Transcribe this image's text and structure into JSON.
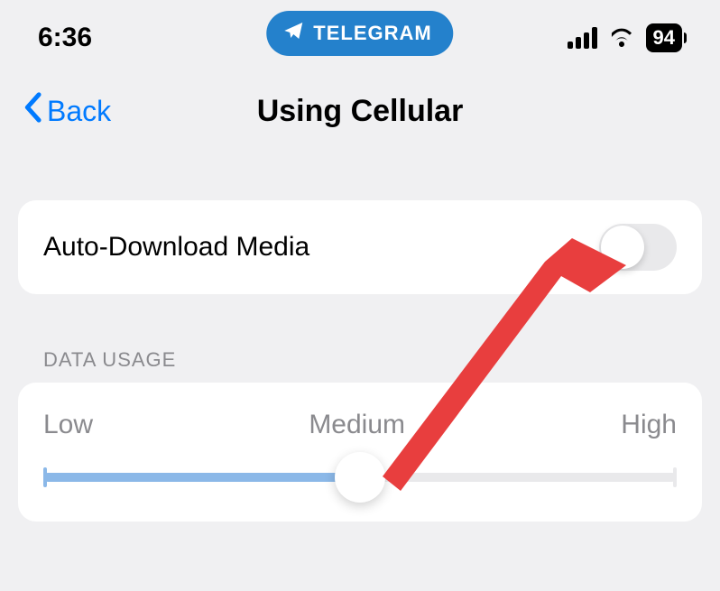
{
  "status": {
    "time": "6:36",
    "app_name": "TELEGRAM",
    "battery": "94"
  },
  "nav": {
    "back_label": "Back",
    "title": "Using Cellular"
  },
  "auto_download": {
    "label": "Auto-Download Media",
    "enabled": false
  },
  "data_usage": {
    "section_title": "DATA USAGE",
    "low_label": "Low",
    "medium_label": "Medium",
    "high_label": "High",
    "value": "Medium",
    "slider_percent": 50
  },
  "colors": {
    "accent": "#007aff",
    "badge": "#2481cc",
    "slider_fill": "#8bb8e8",
    "arrow": "#e83e3e"
  }
}
